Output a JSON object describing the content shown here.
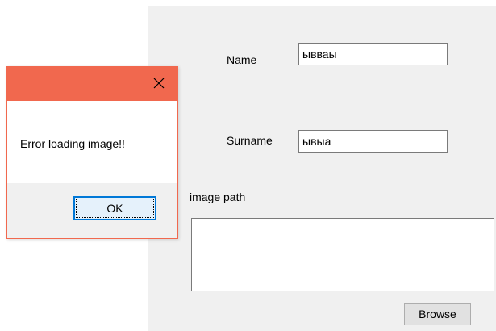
{
  "form": {
    "name_label": "Name",
    "name_value": "ывваы",
    "surname_label": "Surname",
    "surname_value": "ывыа",
    "image_path_label": "image path",
    "image_path_value": "",
    "browse_label": "Browse"
  },
  "message_box": {
    "message": "Error loading image!!",
    "ok_label": "OK",
    "close_icon": "close-icon",
    "title_bar_color": "#f1684e",
    "focus_color": "#0078d7"
  }
}
